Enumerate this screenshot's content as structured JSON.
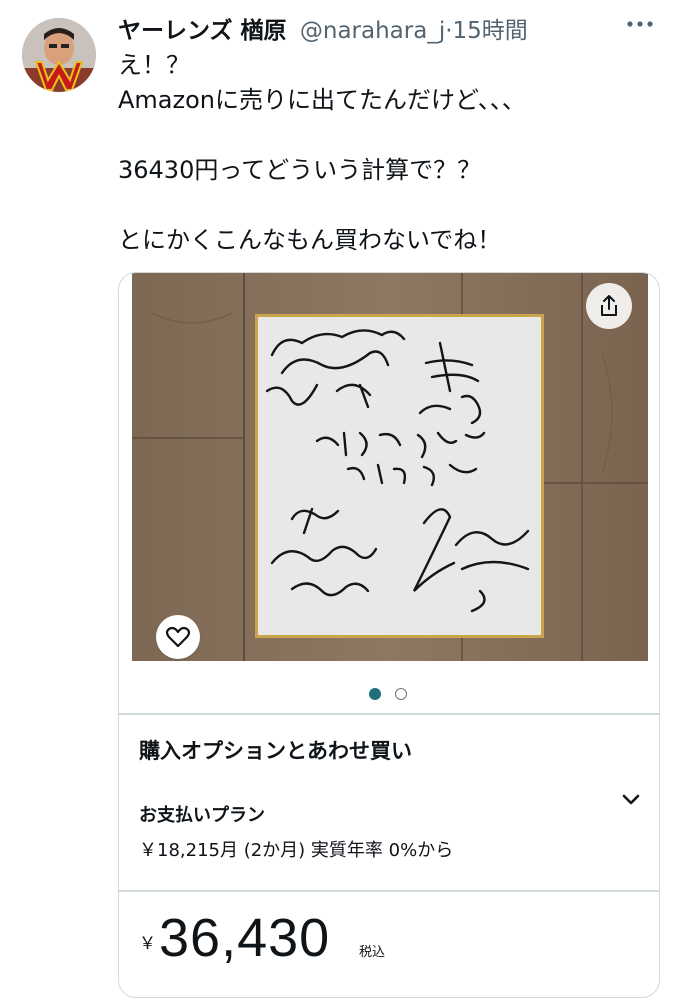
{
  "tweet": {
    "display_name": "ヤーレンズ 楢原",
    "handle": "@narahara_j",
    "separator": "·",
    "time": "15時間",
    "more_icon": "more-horizontal-icon",
    "lines": [
      "え！？",
      "Amazonに売りに出てたんだけど、、、",
      "",
      "36430円ってどういう計算で？？",
      "",
      "とにかくこんなもん買わないでね！"
    ]
  },
  "card": {
    "share_icon": "share-icon",
    "favorite_icon": "heart-outline-icon",
    "image_count": 2,
    "current_image": 1,
    "section_title": "購入オプションとあわせ買い",
    "payment_plan_label": "お支払いプラン",
    "payment_plan_detail": "￥18,215月 (2か月) 実質年率 0%から",
    "expand_icon": "chevron-down-icon",
    "price_symbol": "￥",
    "price_value": "36,430",
    "tax_note": "税込"
  },
  "colors": {
    "accent_dot": "#1f6e7a",
    "avatar_red": "#c8191c",
    "avatar_gold": "#e8c21c",
    "border": "#cfd9de",
    "secondary_text": "#536471"
  }
}
